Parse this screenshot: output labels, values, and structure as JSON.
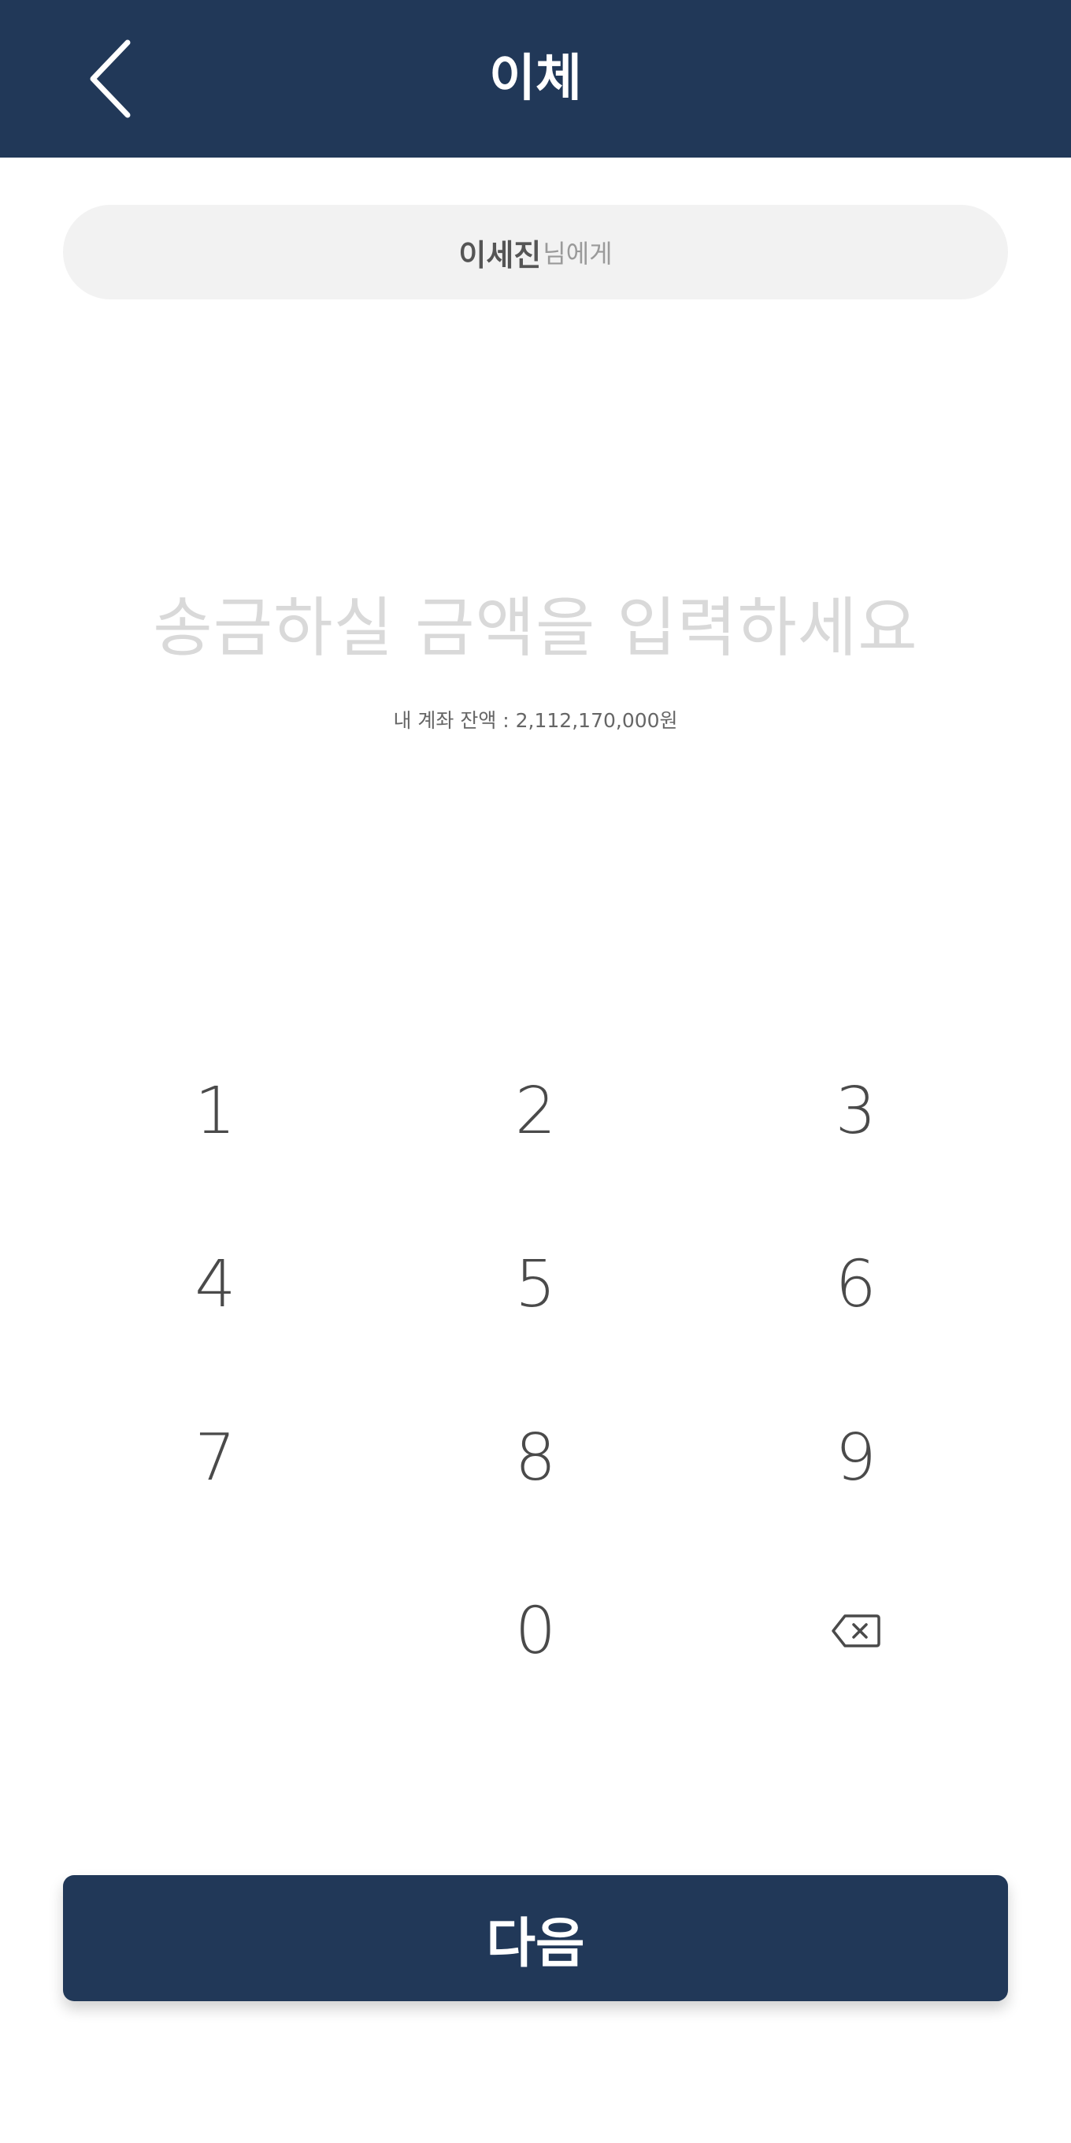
{
  "header": {
    "title": "이체",
    "back_icon": "chevron-left-icon"
  },
  "recipient": {
    "name": "이세진",
    "suffix": "님에게"
  },
  "amount": {
    "placeholder": "송금하실 금액을 입력하세요"
  },
  "balance": {
    "text": "내 계좌 잔액 : 2,112,170,000원"
  },
  "keypad": {
    "keys": [
      "1",
      "2",
      "3",
      "4",
      "5",
      "6",
      "7",
      "8",
      "9",
      "",
      "0"
    ],
    "backspace_icon": "backspace-icon"
  },
  "footer": {
    "next_label": "다음"
  },
  "colors": {
    "brand": "#213858",
    "pill_background": "#f2f2f2",
    "placeholder_text": "#d9d9d9",
    "key_text": "#4a4a4a"
  }
}
